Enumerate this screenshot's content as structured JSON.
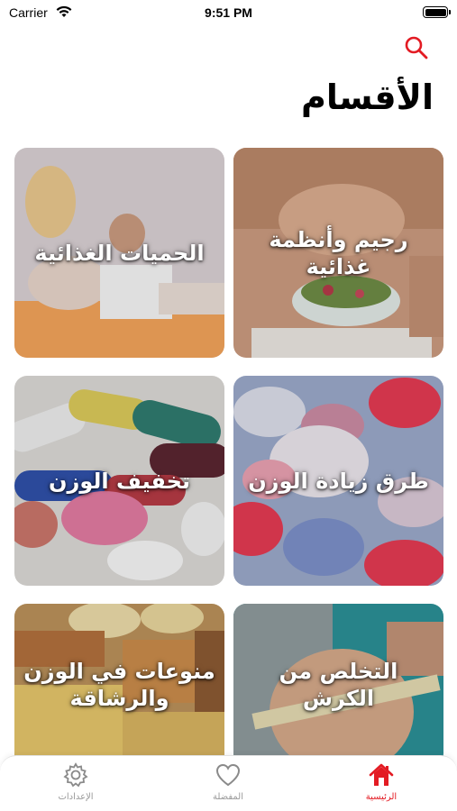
{
  "status_bar": {
    "carrier": "Carrier",
    "time": "9:51 PM",
    "wifi_icon": "wifi-icon",
    "battery_icon": "battery-icon"
  },
  "header": {
    "title": "الأقسام",
    "search_icon": "search-icon",
    "accent_color": "#e31b23"
  },
  "categories": [
    {
      "label": "رجيم وأنظمة غذائية",
      "image": "abs-salad-photo"
    },
    {
      "label": "الحميات الغذائية",
      "image": "yoga-mother-child-photo"
    },
    {
      "label": "طرق زيادة الوزن",
      "image": "colorful-pills-photo"
    },
    {
      "label": "تخفيف الوزن",
      "image": "capsules-tablets-photo"
    },
    {
      "label": "التخلص من الكرش",
      "image": "measuring-tape-waist-photo"
    },
    {
      "label": "منوعات في الوزن والرشاقة",
      "image": "bread-pasta-photo"
    }
  ],
  "tab_bar": {
    "tabs": [
      {
        "label": "الرئيسية",
        "icon": "home-icon",
        "active": true
      },
      {
        "label": "المفضلة",
        "icon": "heart-icon",
        "active": false
      },
      {
        "label": "الإعدادات",
        "icon": "gear-icon",
        "active": false
      }
    ]
  }
}
